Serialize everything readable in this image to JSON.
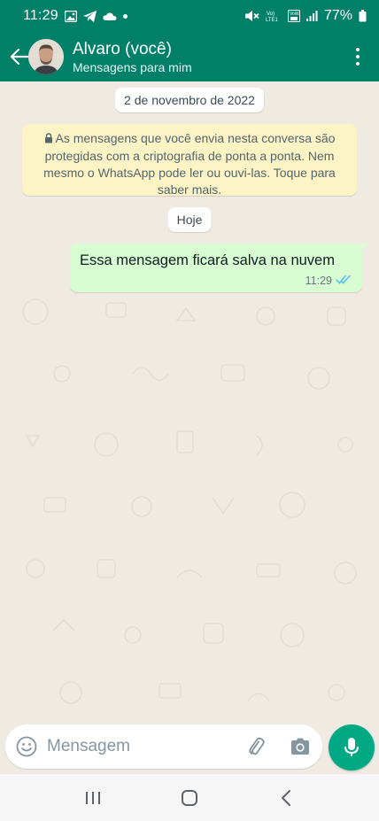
{
  "status_bar": {
    "time": "11:29",
    "battery": "77%",
    "network": "VoLTE",
    "icons": [
      "image-icon",
      "telegram-icon",
      "cloud-icon",
      "dot-icon",
      "mute-icon",
      "volte-icon",
      "wifi-calling-icon",
      "signal-icon",
      "battery-icon"
    ]
  },
  "header": {
    "title": "Alvaro (você)",
    "subtitle": "Mensagens para mim",
    "icons": [
      "back-arrow-icon",
      "avatar",
      "more-vert-icon"
    ]
  },
  "chat": {
    "date_chip": "2 de novembro de 2022",
    "encryption_notice": "As mensagens que você envia nesta conversa são protegidas com a criptografia de ponta a ponta. Nem mesmo o WhatsApp pode ler ou ouvi-las. Toque para saber mais.",
    "today_chip": "Hoje",
    "messages": [
      {
        "text": "Essa mensagem ficará salva na nuvem",
        "time": "11:29",
        "status": "read",
        "outgoing": true
      }
    ]
  },
  "composer": {
    "placeholder": "Mensagem",
    "icons": [
      "emoji-icon",
      "attach-icon",
      "camera-icon",
      "mic-icon"
    ]
  },
  "nav_bar": {
    "icons": [
      "recent-apps-icon",
      "home-icon",
      "back-icon"
    ]
  },
  "colors": {
    "header": "#008069",
    "chat_background": "#efeae2",
    "outgoing_bubble": "#d9fdd3",
    "encryption_bg": "#fdf4c5",
    "mic_button": "#00a884",
    "read_ticks": "#53bdeb"
  }
}
